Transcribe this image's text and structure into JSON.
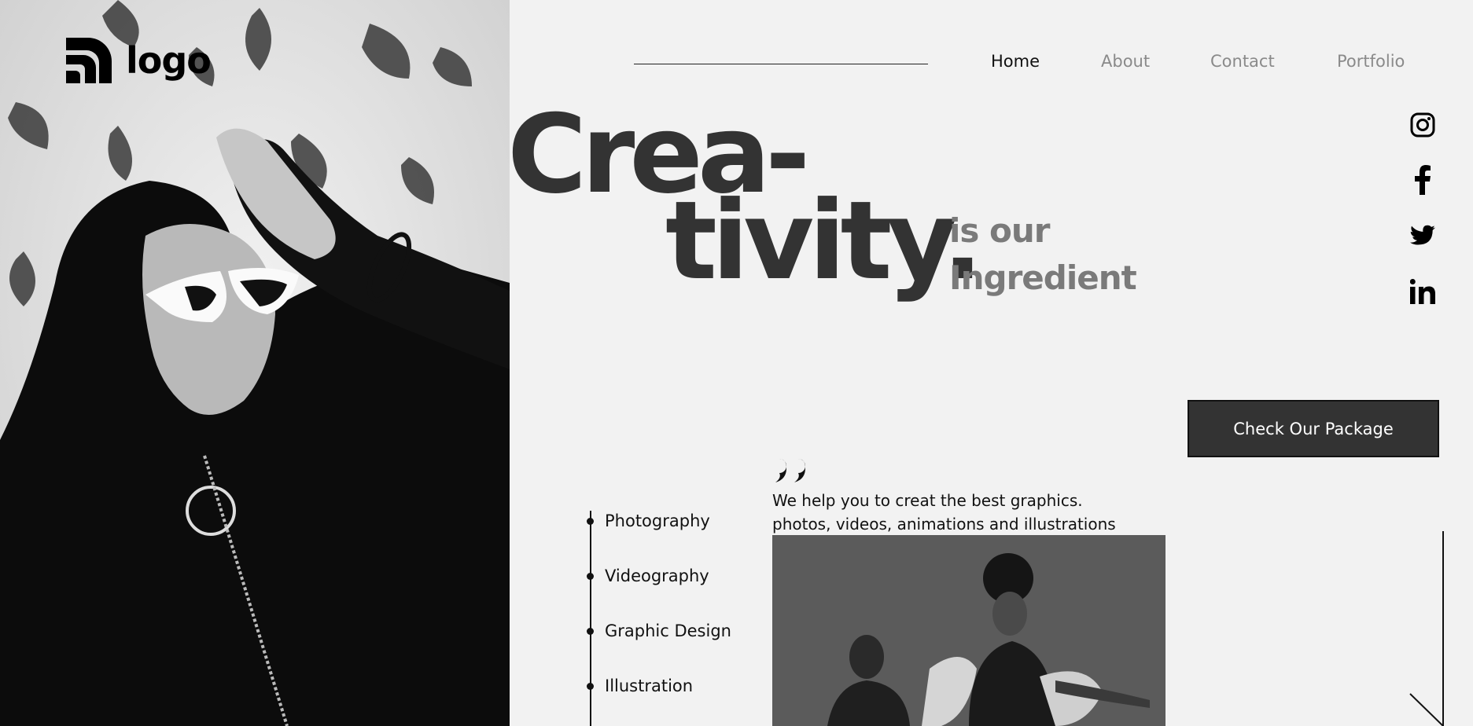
{
  "logo": {
    "text": "logo"
  },
  "nav": {
    "items": [
      {
        "label": "Home",
        "active": true
      },
      {
        "label": "About",
        "active": false
      },
      {
        "label": "Contact",
        "active": false
      },
      {
        "label": "Portfolio",
        "active": false
      }
    ]
  },
  "hero": {
    "line1": "Crea-",
    "line2": "tivity.",
    "tagline_line1": "is our",
    "tagline_line2": "Ingredient"
  },
  "cta": {
    "label": "Check Our Package"
  },
  "services": [
    "Photography",
    "Videography",
    "Graphic Design",
    "Illustration"
  ],
  "quote": {
    "line1": "We help you to creat the best graphics.",
    "line2": "photos, videos, animations and illustrations"
  },
  "social": [
    "instagram-icon",
    "facebook-icon",
    "twitter-icon",
    "linkedin-icon"
  ],
  "colors": {
    "background": "#f2f2f2",
    "hero_text": "#333333",
    "tagline": "#7a7a7a",
    "cta_bg": "#333333",
    "nav_inactive": "#8a8a8a"
  }
}
